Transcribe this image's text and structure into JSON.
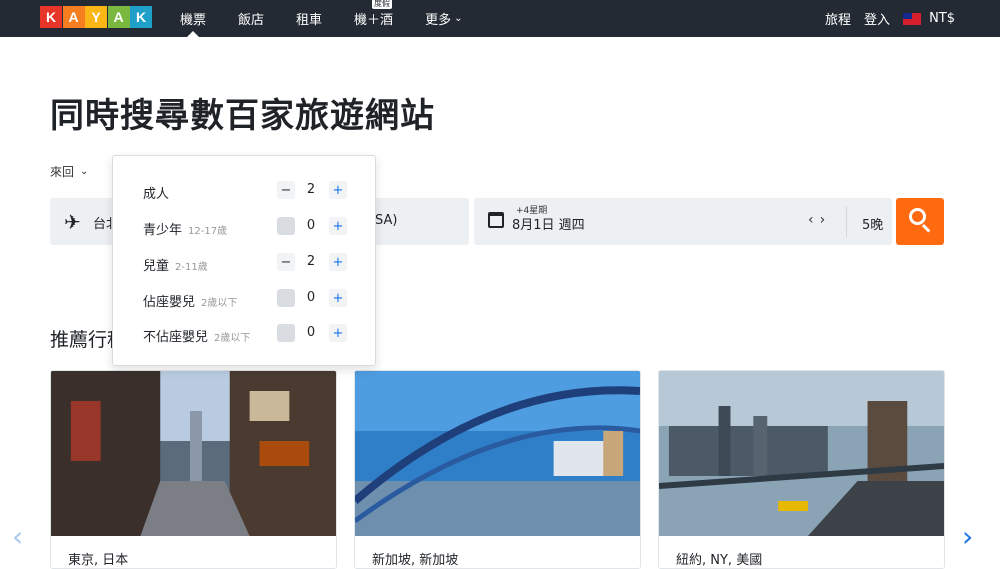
{
  "header": {
    "logo_letters": [
      "K",
      "A",
      "Y",
      "A",
      "K"
    ],
    "logo_colors": [
      "#e8352a",
      "#f57e20",
      "#f9b615",
      "#7bb83f",
      "#1fa0c8"
    ],
    "nav": [
      {
        "label": "機票",
        "active": true
      },
      {
        "label": "飯店",
        "active": false
      },
      {
        "label": "租車",
        "active": false
      },
      {
        "label": "機＋酒",
        "badge": "度假",
        "active": false
      },
      {
        "label": "更多",
        "has_dropdown": true,
        "active": false
      }
    ],
    "trips": "旅程",
    "login": "登入",
    "currency": "NT$"
  },
  "main": {
    "headline": "同時搜尋數百家旅遊網站",
    "trip_type": "來回",
    "search": {
      "origin": "台北",
      "destination_suffix": "SA)",
      "date_hint": "+4星期",
      "date": "8月1日 週四",
      "nights": "5晚"
    },
    "section_title": "推薦行程"
  },
  "travelers": [
    {
      "label": "成人",
      "sub": "",
      "count": "2",
      "minus_enabled": true
    },
    {
      "label": "青少年",
      "sub": "12-17歲",
      "count": "0",
      "minus_enabled": false
    },
    {
      "label": "兒童",
      "sub": "2-11歲",
      "count": "2",
      "minus_enabled": true
    },
    {
      "label": "佔座嬰兒",
      "sub": "2歲以下",
      "count": "0",
      "minus_enabled": false
    },
    {
      "label": "不佔座嬰兒",
      "sub": "2歲以下",
      "count": "0",
      "minus_enabled": false
    }
  ],
  "cards": [
    {
      "caption": "東京, 日本"
    },
    {
      "caption": "新加坡, 新加坡"
    },
    {
      "caption": "紐約, NY, 美國"
    }
  ],
  "colors": {
    "topbar": "#232a33",
    "accent_orange": "#ff690f",
    "link_blue": "#1a73e8",
    "field_bg": "#edf0f3"
  }
}
